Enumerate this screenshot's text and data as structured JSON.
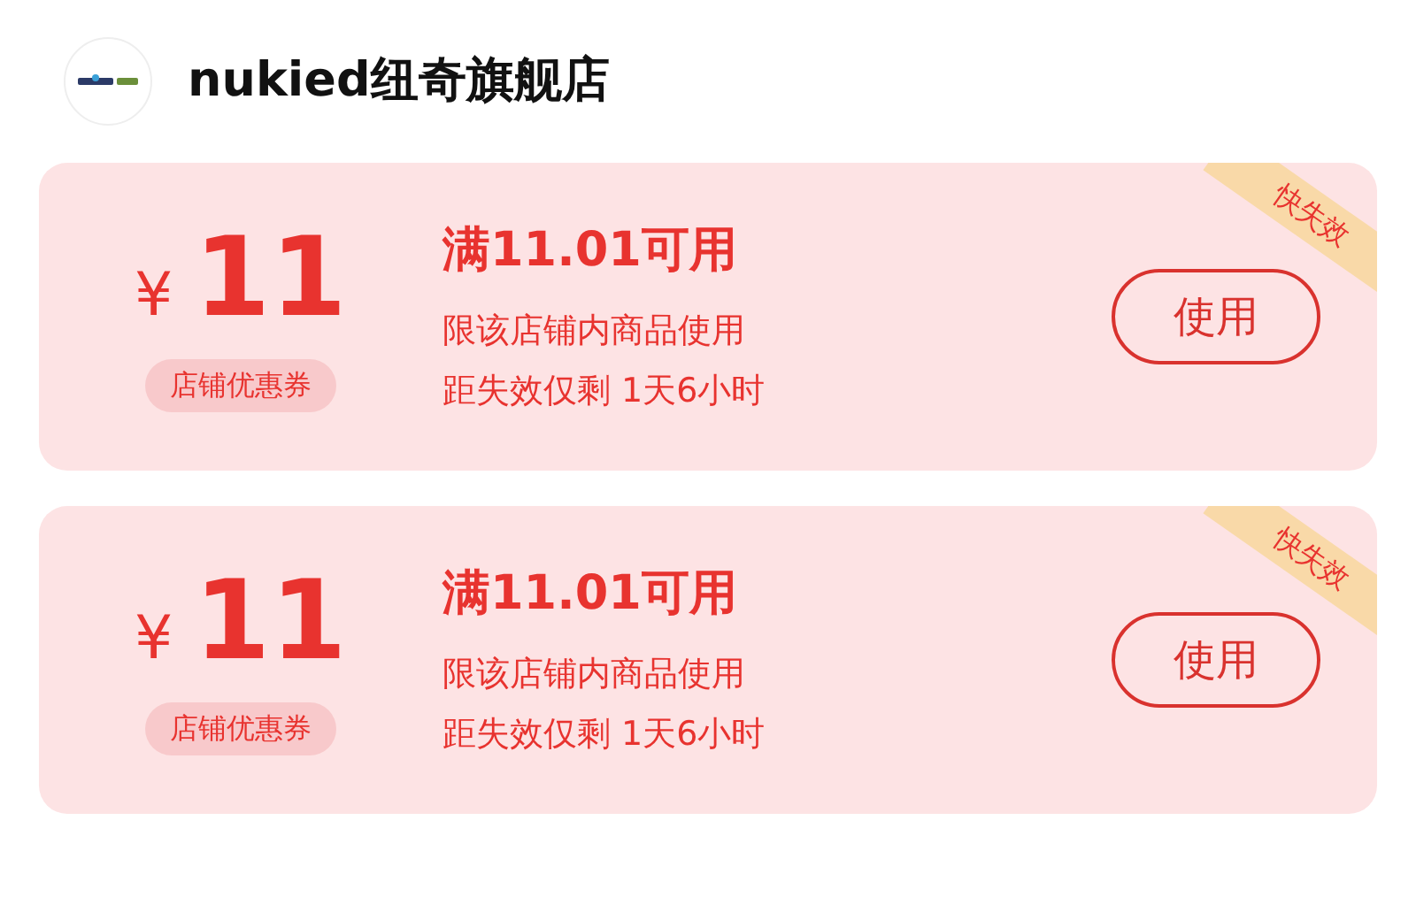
{
  "store": {
    "name": "nukied纽奇旗舰店"
  },
  "coupons": [
    {
      "currency": "¥",
      "amount": "11",
      "type_label": "店铺优惠券",
      "condition": "满11.01可用",
      "scope": "限该店铺内商品使用",
      "expiry": "距失效仅剩 1天6小时",
      "button": "使用",
      "corner_tag": "快失效"
    },
    {
      "currency": "¥",
      "amount": "11",
      "type_label": "店铺优惠券",
      "condition": "满11.01可用",
      "scope": "限该店铺内商品使用",
      "expiry": "距失效仅剩 1天6小时",
      "button": "使用",
      "corner_tag": "快失效"
    }
  ]
}
